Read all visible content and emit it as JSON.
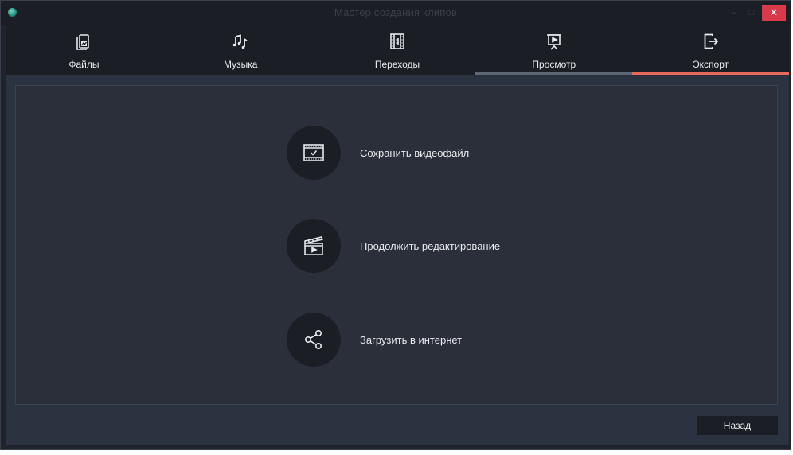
{
  "window": {
    "title": "Мастер создания клипов",
    "controls": {
      "minimize": "–",
      "maximize": "□",
      "close": "✕"
    }
  },
  "tabs": [
    {
      "label": "Файлы",
      "icon": "image-file-icon",
      "state": "normal"
    },
    {
      "label": "Музыка",
      "icon": "music-notes-icon",
      "state": "normal"
    },
    {
      "label": "Переходы",
      "icon": "transition-icon",
      "state": "normal"
    },
    {
      "label": "Просмотр",
      "icon": "presentation-play-icon",
      "state": "visited"
    },
    {
      "label": "Экспорт",
      "icon": "export-arrow-icon",
      "state": "active"
    }
  ],
  "options": [
    {
      "label": "Сохранить видеофайл",
      "icon": "filmstrip-check-icon"
    },
    {
      "label": "Продолжить редактирование",
      "icon": "clapperboard-icon"
    },
    {
      "label": "Загрузить в интернет",
      "icon": "share-icon"
    }
  ],
  "footer": {
    "back_label": "Назад"
  },
  "colors": {
    "background": "#1f232b",
    "content": "#2c3340",
    "panel": "#2a2f3a",
    "accent_active": "#e86a5c",
    "accent_visited": "#5d6674",
    "close_button": "#d9394b",
    "text": "#e8eaed"
  }
}
